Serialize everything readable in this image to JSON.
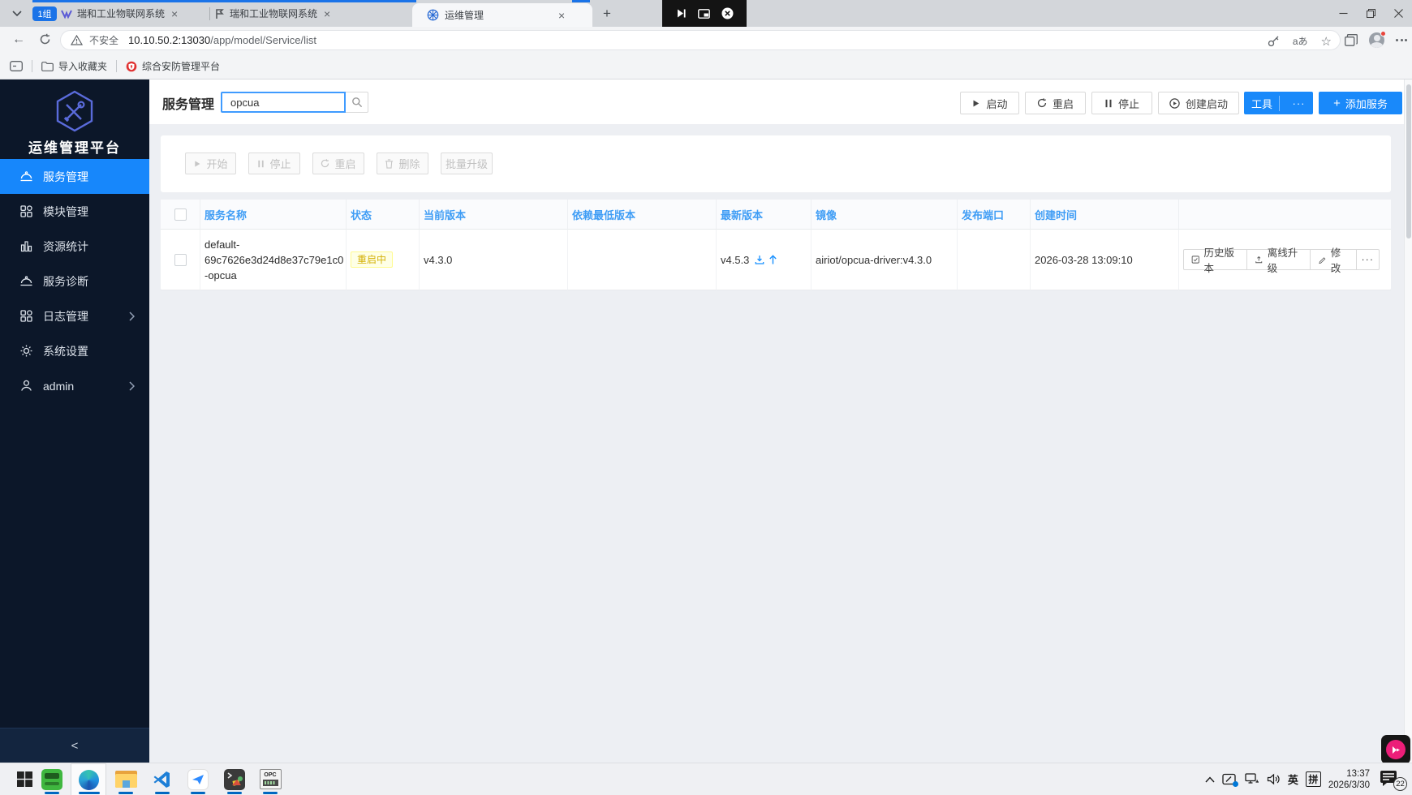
{
  "browser": {
    "tab_group_label": "1组",
    "tabs": [
      {
        "title": "瑞和工业物联网系统"
      },
      {
        "title": "瑞和工业物联网系统"
      },
      {
        "title": "运维管理"
      }
    ],
    "new_tab_glyph": "+",
    "address": {
      "security_label": "不安全",
      "host": "10.10.50.2:13030",
      "path": "/app/model/Service/list",
      "translate_glyph": "aあ"
    },
    "bookmarks_bar": {
      "import_label": "导入收藏夹",
      "security_platform_label": "综合安防管理平台"
    }
  },
  "sidebar": {
    "platform_title": "运维管理平台",
    "items": [
      {
        "label": "服务管理"
      },
      {
        "label": "模块管理"
      },
      {
        "label": "资源统计"
      },
      {
        "label": "服务诊断"
      },
      {
        "label": "日志管理"
      },
      {
        "label": "系统设置"
      },
      {
        "label": "admin"
      }
    ],
    "collapse_glyph": "<"
  },
  "main": {
    "page_title": "服务管理",
    "search": {
      "value": "opcua"
    },
    "header_actions": {
      "start": "启动",
      "restart": "重启",
      "stop": "停止",
      "create_start": "创建启动",
      "tools": "工具",
      "tools_more": "···",
      "add_plus": "+",
      "add_service": "添加服务"
    },
    "batch_actions": {
      "start": "开始",
      "stop": "停止",
      "restart": "重启",
      "delete": "删除",
      "batch_upgrade": "批量升级"
    },
    "table": {
      "headers": [
        "服务名称",
        "状态",
        "当前版本",
        "依赖最低版本",
        "最新版本",
        "镜像",
        "发布端口",
        "创建时间"
      ],
      "row": {
        "name": "default-69c7626e3d24d8e37c79e1c0-opcua",
        "name_lines": [
          "default-",
          "69c7626e3d24d8e37c79e1c0",
          "-opcua"
        ],
        "status": "重启中",
        "current_version": "v4.3.0",
        "min_dependency_version": "",
        "latest_version": "v4.5.3",
        "image": "airiot/opcua-driver:v4.3.0",
        "port": "",
        "created_at": "2026-03-28 13:09:10",
        "actions": {
          "history": "历史版本",
          "offline_upgrade": "离线升级",
          "modify": "修改",
          "more": "···"
        }
      }
    }
  },
  "taskbar": {
    "lang_primary": "英",
    "lang_secondary": "拼",
    "time": "13:37",
    "date": "2026/3/30",
    "notification_count": "22"
  },
  "colors": {
    "accent": "#1890ff",
    "tab_group": "#1a73e8",
    "sidebar_bg": "#0c1729",
    "table_header_text": "#3f9df5",
    "status_warning_text": "#d4b106",
    "status_warning_bg": "#feffe6",
    "status_warning_border": "#fffb8f"
  }
}
